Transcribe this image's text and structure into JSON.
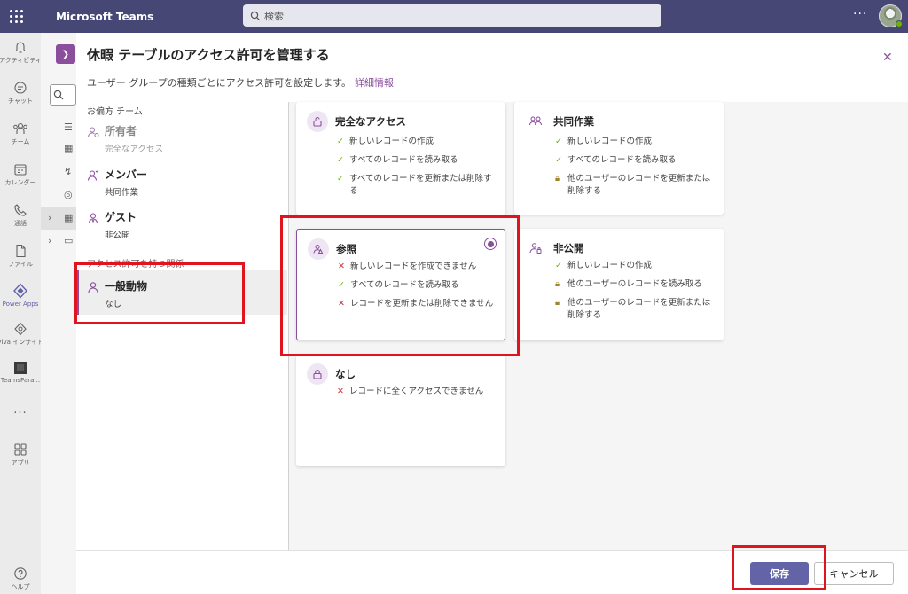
{
  "topbar": {
    "app_title": "Microsoft Teams",
    "search_placeholder": "検索",
    "more": "···"
  },
  "rail": {
    "items": [
      {
        "label": "アクティビティ",
        "icon": "bell-icon"
      },
      {
        "label": "チャット",
        "icon": "chat-icon"
      },
      {
        "label": "チーム",
        "icon": "teams-icon"
      },
      {
        "label": "カレンダー",
        "icon": "calendar-icon"
      },
      {
        "label": "通話",
        "icon": "phone-icon"
      },
      {
        "label": "ファイル",
        "icon": "file-icon"
      },
      {
        "label": "Power Apps",
        "icon": "power-apps-icon"
      },
      {
        "label": "Viva インサイト",
        "icon": "viva-insights-icon"
      },
      {
        "label": "TeamsPara...",
        "icon": "teams-para-icon"
      },
      {
        "label": "···",
        "icon": "more-icon"
      },
      {
        "label": "アプリ",
        "icon": "apps-icon"
      },
      {
        "label": "ヘルプ",
        "icon": "help-icon"
      }
    ]
  },
  "panel": {
    "title": "休暇 テーブルのアクセス許可を管理する",
    "subtitle": "ユーザー グループの種類ごとにアクセス許可を設定します。",
    "link": "詳細情報",
    "close": "✕",
    "section_team": "お偏方 チーム",
    "section_others": "アクセス許可を持つ関係",
    "roles": [
      {
        "name": "所有者",
        "perm": "完全なアクセス"
      },
      {
        "name": "メンバー",
        "perm": "共同作業"
      },
      {
        "name": "ゲスト",
        "perm": "非公開"
      },
      {
        "name": "一般動物",
        "perm": "なし"
      }
    ]
  },
  "options": [
    {
      "title": "完全なアクセス",
      "icon": "unlock-icon",
      "features": [
        {
          "mark": "check",
          "text": "新しいレコードの作成"
        },
        {
          "mark": "check",
          "text": "すべてのレコードを読み取る"
        },
        {
          "mark": "check",
          "text": "すべてのレコードを更新または削除する"
        }
      ]
    },
    {
      "title": "共同作業",
      "icon": "collaborate-icon",
      "features": [
        {
          "mark": "check",
          "text": "新しいレコードの作成"
        },
        {
          "mark": "check",
          "text": "すべてのレコードを読み取る"
        },
        {
          "mark": "lock",
          "text": "他のユーザーのレコードを更新または削除する"
        }
      ]
    },
    {
      "title": "参照",
      "icon": "reference-icon",
      "selected": true,
      "features": [
        {
          "mark": "x",
          "text": "新しいレコードを作成できません"
        },
        {
          "mark": "check",
          "text": "すべてのレコードを読み取る"
        },
        {
          "mark": "x",
          "text": "レコードを更新または削除できません"
        }
      ]
    },
    {
      "title": "非公開",
      "icon": "private-icon",
      "features": [
        {
          "mark": "check",
          "text": "新しいレコードの作成"
        },
        {
          "mark": "lock",
          "text": "他のユーザーのレコードを読み取る"
        },
        {
          "mark": "lock",
          "text": "他のユーザーのレコードを更新または削除する"
        }
      ]
    },
    {
      "title": "なし",
      "icon": "lock-icon",
      "features": [
        {
          "mark": "x",
          "text": "レコードに全くアクセスできません"
        }
      ]
    }
  ],
  "footer": {
    "save": "保存",
    "cancel": "キャンセル"
  },
  "colors": {
    "accent": "#6264a7",
    "brand_purple": "#8a4e9d",
    "topbar": "#464775",
    "check": "#6bb700",
    "cross": "#d13438",
    "annotation_red": "#e0141e"
  }
}
